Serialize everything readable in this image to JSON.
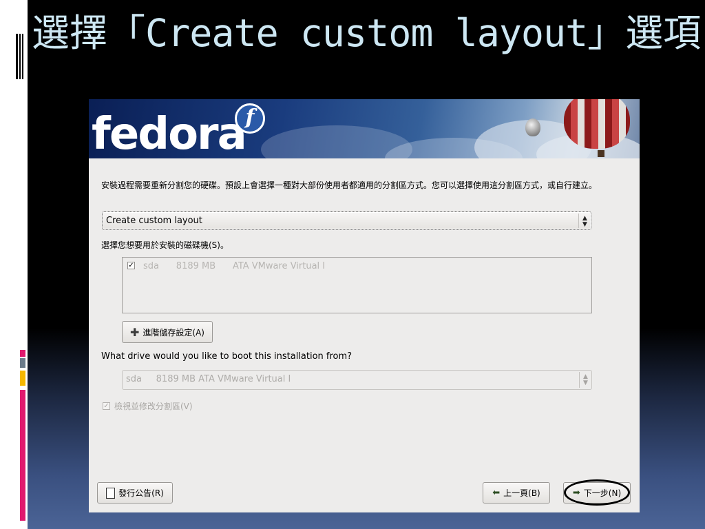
{
  "slide": {
    "title_prefix": "選擇「",
    "title_code": "Create custom layout",
    "title_suffix": "」選項"
  },
  "banner": {
    "logo_text": "fedora",
    "logo_mark": "f"
  },
  "installer": {
    "intro_text": "安裝過程需要重新分割您的硬碟。預設上會選擇一種對大部份使用者都適用的分割區方式。您可以選擇使用這分割區方式，或自行建立。",
    "layout_select_value": "Create custom layout",
    "drive_label": "選擇您想要用於安裝的磁碟機(S)。",
    "drive_list": [
      {
        "checked": true,
        "name": "sda",
        "size": "8189 MB",
        "model": "ATA VMware Virtual I"
      }
    ],
    "advanced_button": "進階儲存設定(A)",
    "boot_question": "What drive would you like to boot this installation from?",
    "boot_select_value": "sda     8189 MB ATA VMware Virtual I",
    "review_label": "檢視並修改分割區(V)",
    "release_notes_button": "發行公告(R)",
    "back_button": "上一頁(B)",
    "next_button": "下一步(N)"
  },
  "icons": {
    "checkbox": "checkbox-checked-icon",
    "advanced": "plus-icon",
    "release_notes": "document-icon",
    "back": "arrow-left-icon",
    "next": "arrow-right-icon"
  }
}
